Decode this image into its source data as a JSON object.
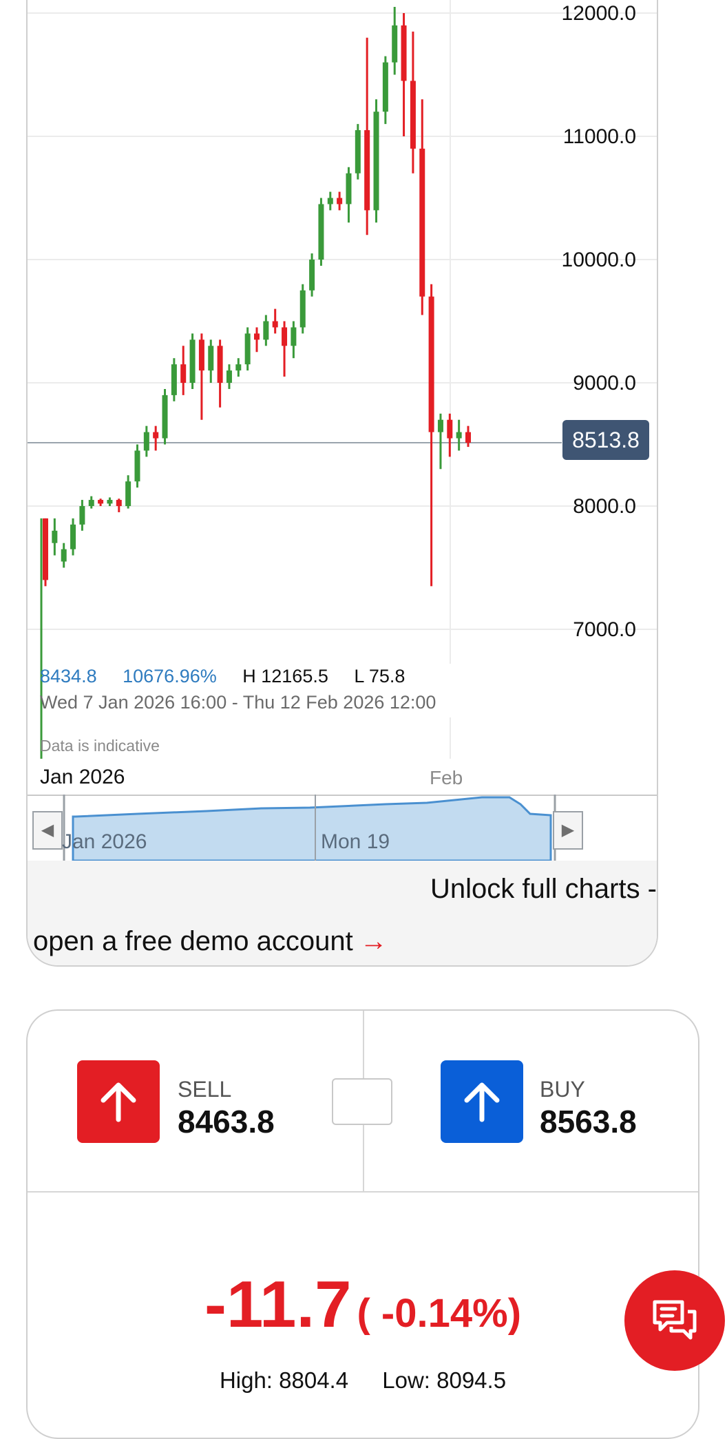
{
  "chart": {
    "current_price_tag": "8513.8",
    "stats": {
      "price": "8434.8",
      "change_pct": "10676.96%",
      "high": "H 12165.5",
      "low": "L 75.8"
    },
    "date_range": "Wed 7 Jan 2026 16:00 - Thu 12 Feb 2026 12:00",
    "disclaimer": "Data is indicative",
    "x_axis_month": "Jan 2026",
    "x_axis_feb": "Feb",
    "navigator": {
      "label_left": "Jan 2026",
      "label_mid": "Mon 19",
      "left_arrow_icon": "chevron-left-icon",
      "right_arrow_icon": "chevron-right-icon"
    },
    "unlock_line1": "Unlock full charts -",
    "unlock_line2": "open a free demo account",
    "unlock_arrow": "→",
    "colors": {
      "up": "#3a9a3a",
      "down": "#e31e24",
      "price_tag": "#3f5573",
      "navigator_fill": "#c2dbf0"
    }
  },
  "chart_data": {
    "type": "candlestick",
    "ylim": [
      6600,
      12100
    ],
    "y_ticks": [
      "12000.0",
      "11000.0",
      "10000.0",
      "9000.0",
      "8000.0",
      "7000.0"
    ],
    "current_price": 8513.8,
    "candles": [
      [
        7900,
        7400,
        7900,
        7350
      ],
      [
        7700,
        7800,
        7900,
        7600
      ],
      [
        7550,
        7650,
        7700,
        7500
      ],
      [
        7650,
        7850,
        7900,
        7600
      ],
      [
        7850,
        8000,
        8050,
        7800
      ],
      [
        8000,
        8050,
        8080,
        7980
      ],
      [
        8050,
        8020,
        8060,
        8000
      ],
      [
        8020,
        8050,
        8070,
        8000
      ],
      [
        8050,
        8000,
        8060,
        7950
      ],
      [
        8000,
        8200,
        8250,
        7980
      ],
      [
        8200,
        8450,
        8500,
        8150
      ],
      [
        8450,
        8600,
        8650,
        8400
      ],
      [
        8600,
        8550,
        8650,
        8450
      ],
      [
        8550,
        8900,
        8950,
        8500
      ],
      [
        8900,
        9150,
        9200,
        8850
      ],
      [
        9150,
        9000,
        9300,
        8900
      ],
      [
        9000,
        9350,
        9400,
        8950
      ],
      [
        9350,
        9100,
        9400,
        8700
      ],
      [
        9100,
        9300,
        9350,
        9000
      ],
      [
        9300,
        9000,
        9350,
        8800
      ],
      [
        9000,
        9100,
        9150,
        8950
      ],
      [
        9100,
        9150,
        9200,
        9050
      ],
      [
        9150,
        9400,
        9450,
        9100
      ],
      [
        9400,
        9350,
        9450,
        9250
      ],
      [
        9350,
        9500,
        9550,
        9300
      ],
      [
        9500,
        9450,
        9600,
        9400
      ],
      [
        9450,
        9300,
        9500,
        9050
      ],
      [
        9300,
        9450,
        9500,
        9200
      ],
      [
        9450,
        9750,
        9800,
        9400
      ],
      [
        9750,
        10000,
        10050,
        9700
      ],
      [
        10000,
        10450,
        10500,
        9950
      ],
      [
        10450,
        10500,
        10550,
        10400
      ],
      [
        10500,
        10450,
        10550,
        10400
      ],
      [
        10450,
        10700,
        10750,
        10300
      ],
      [
        10700,
        11050,
        11100,
        10650
      ],
      [
        11050,
        10400,
        11800,
        10200
      ],
      [
        10400,
        11200,
        11300,
        10300
      ],
      [
        11200,
        11600,
        11650,
        11100
      ],
      [
        11600,
        11900,
        12050,
        11500
      ],
      [
        11900,
        11450,
        12000,
        11000
      ],
      [
        11450,
        10900,
        11850,
        10700
      ],
      [
        10900,
        9700,
        11300,
        9550
      ],
      [
        9700,
        8600,
        9800,
        7350
      ],
      [
        8600,
        8700,
        8750,
        8300
      ],
      [
        8700,
        8550,
        8750,
        8400
      ],
      [
        8550,
        8600,
        8700,
        8450
      ],
      [
        8600,
        8513.8,
        8650,
        8480
      ]
    ]
  },
  "trade": {
    "sell_label": "SELL",
    "sell_price": "8463.8",
    "sell_icon": "arrow-up-icon",
    "buy_label": "BUY",
    "buy_price": "8563.8",
    "buy_icon": "arrow-up-icon",
    "change_value": "-11.7",
    "change_pct": "( -0.14%)",
    "high": "High: 8804.4",
    "low": "Low: 8094.5"
  },
  "chat": {
    "icon": "chat-bubbles-icon"
  }
}
